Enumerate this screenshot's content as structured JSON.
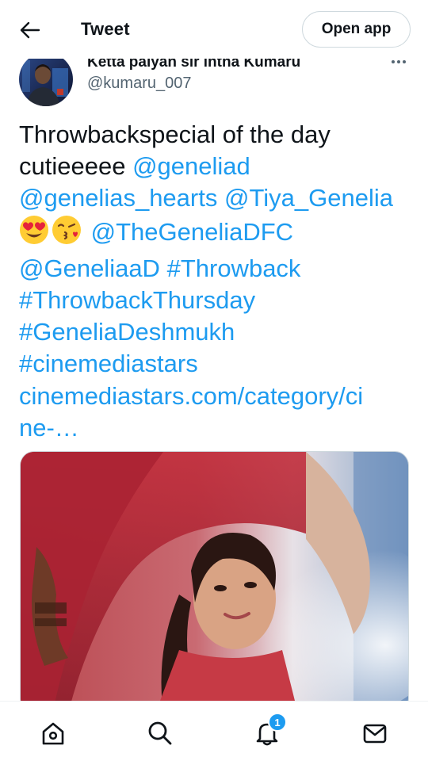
{
  "header": {
    "title": "Tweet",
    "open_app_label": "Open app"
  },
  "author": {
    "display_name": "Ketta paiyan sir intha Kumaru",
    "handle": "@kumaru_007"
  },
  "tweet": {
    "line1": "Throwbackspecial of the day",
    "line2_text": "cutieeeee",
    "mention1": "@geneliad",
    "mention2": "@genelias_hearts",
    "mention3": "@Tiya_Genelia",
    "emoji1": "heart-eyes-emoji",
    "emoji2": "kissing-face-emoji",
    "mention4": "@TheGeneliaDFC",
    "mention5": "@GeneliaaD",
    "hashtag1": "#Throwback",
    "hashtag2": "#ThrowbackThursday",
    "hashtag3": "#GeneliaDeshmukh",
    "hashtag4": "#cinemediastars",
    "link_line1": "cinemediastars.com/category/ci",
    "link_line2": "ne-…"
  },
  "bottom_nav": {
    "items": [
      "home-icon",
      "search-icon",
      "notifications-icon",
      "messages-icon"
    ],
    "notification_count": "1"
  },
  "colors": {
    "accent": "#1d9bf0",
    "text": "#0f1419",
    "secondary": "#536471"
  }
}
